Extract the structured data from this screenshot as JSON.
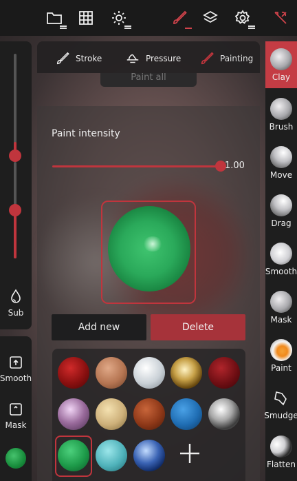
{
  "topbar": {
    "icons": [
      "folder-icon",
      "grid-icon",
      "sun-icon",
      "brush-icon",
      "layers-icon",
      "gear-icon",
      "tools-icon"
    ]
  },
  "left_panel": {
    "sub_label": "Sub",
    "smooth_label": "Smooth",
    "mask_label": "Mask"
  },
  "tabs": [
    {
      "label": "Stroke",
      "icon": "brush-icon"
    },
    {
      "label": "Pressure",
      "icon": "pressure-icon"
    },
    {
      "label": "Painting",
      "icon": "paint-brush-icon"
    }
  ],
  "paint_all_label": "Paint all",
  "intensity": {
    "label": "Paint intensity",
    "value": "1.00",
    "fraction": 1.0
  },
  "buttons": {
    "add": "Add new",
    "delete": "Delete"
  },
  "tools": [
    {
      "label": "Clay",
      "active": true
    },
    {
      "label": "Brush"
    },
    {
      "label": "Move"
    },
    {
      "label": "Drag"
    },
    {
      "label": "Smooth"
    },
    {
      "label": "Mask"
    },
    {
      "label": "Paint"
    },
    {
      "label": "Smudge"
    },
    {
      "label": "Flatten"
    }
  ],
  "colors": {
    "accent": "#c0353d",
    "panel": "#1e1e1e",
    "active_tool": "#c43c44"
  }
}
